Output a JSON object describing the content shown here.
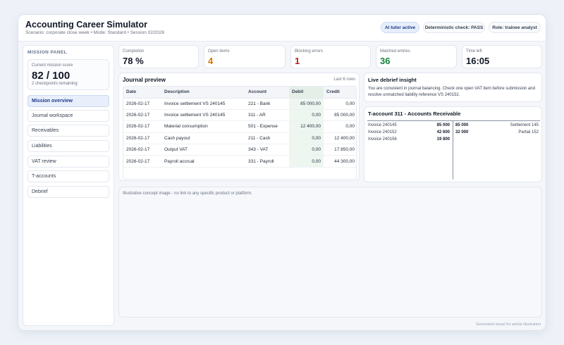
{
  "header": {
    "title": "Accounting Career Simulator",
    "subtitle": "Scenario: corporate close week • Mode: Standard • Session 02/2026",
    "pills": [
      "AI tutor active",
      "Deterministic check: PASS",
      "Role: trainee analyst"
    ]
  },
  "sidebar": {
    "heading": "MISSION PANEL",
    "score_label": "Current mission score",
    "score_value": "82 / 100",
    "score_note": "2 checkpoints remaining",
    "items": [
      {
        "label": "Mission overview"
      },
      {
        "label": "Journal workspace"
      },
      {
        "label": "Receivables"
      },
      {
        "label": "Liabilities"
      },
      {
        "label": "VAT review"
      },
      {
        "label": "T-accounts"
      },
      {
        "label": "Debrief"
      }
    ]
  },
  "kpis": [
    {
      "label": "Completion",
      "value": "78 %",
      "color": "#111827"
    },
    {
      "label": "Open items",
      "value": "4",
      "color": "#d97706"
    },
    {
      "label": "Blocking errors",
      "value": "1",
      "color": "#b91c1c"
    },
    {
      "label": "Matched entries",
      "value": "36",
      "color": "#15803d"
    },
    {
      "label": "Time left",
      "value": "16:05",
      "color": "#111827"
    }
  ],
  "journal": {
    "title": "Journal preview",
    "rows_note": "Last 6 rows",
    "columns": [
      "Date",
      "Description",
      "Account",
      "Debit",
      "Credit"
    ],
    "rows": [
      [
        "2026-02-17",
        "Invoice settlement VS 240145",
        "221 - Bank",
        "85 000,00",
        "0,00"
      ],
      [
        "2026-02-17",
        "Invoice settlement VS 240145",
        "311 - AR",
        "0,00",
        "85 000,00"
      ],
      [
        "2026-02-17",
        "Material consumption",
        "501 - Expense",
        "12 400,00",
        "0,00"
      ],
      [
        "2026-02-17",
        "Cash payout",
        "211 - Cash",
        "0,00",
        "12 400,00"
      ],
      [
        "2026-02-17",
        "Output VAT",
        "343 - VAT",
        "0,00",
        "17 850,00"
      ],
      [
        "2026-02-17",
        "Payroll accrual",
        "331 - Payroll",
        "0,00",
        "44 300,00"
      ]
    ]
  },
  "insight": {
    "title": "Live debrief insight",
    "text": "You are consistent in journal balancing. Check one open VAT item before submission and resolve unmatched liability reference VS 240152."
  },
  "taccount": {
    "title": "T-account 311 - Accounts Receivable",
    "debit": [
      {
        "label": "Invoice 240145",
        "amount": "85 000"
      },
      {
        "label": "Invoice 240152",
        "amount": "42 600"
      },
      {
        "label": "Invoice 240156",
        "amount": "19 800"
      }
    ],
    "credit": [
      {
        "amount": "85 000",
        "label": "Settlement 145"
      },
      {
        "amount": "32 000",
        "label": "Partial 152"
      }
    ]
  },
  "concept_text": "Illustrative concept image - no link to any specific product or platform.",
  "footer_note": "Generated visual for article illustration"
}
